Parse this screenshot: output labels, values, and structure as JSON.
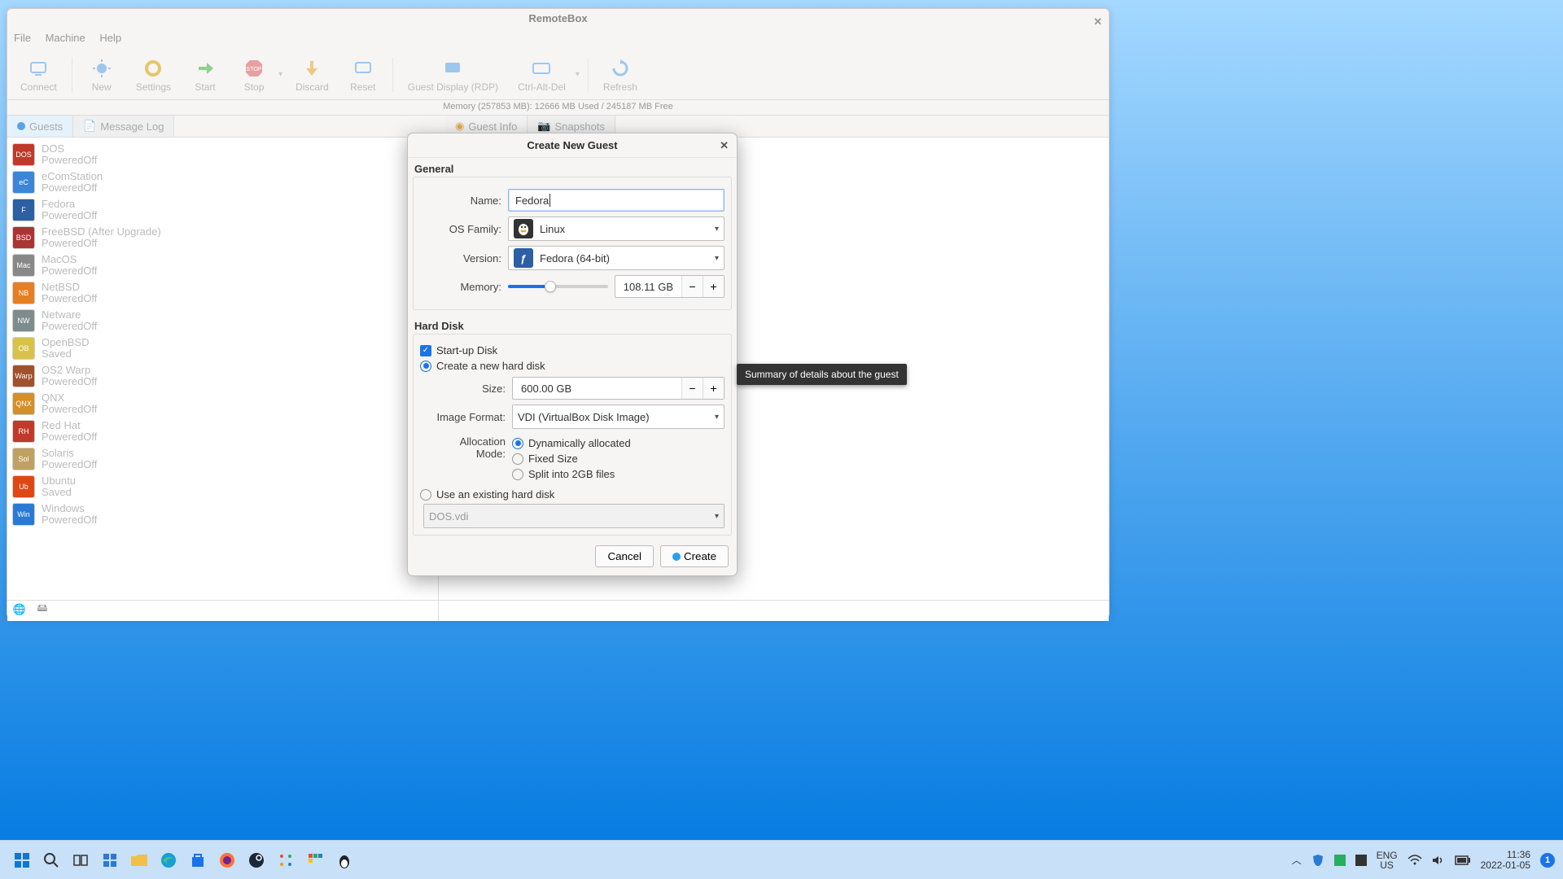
{
  "main_window": {
    "title": "RemoteBox",
    "menu": [
      "File",
      "Machine",
      "Help"
    ],
    "toolbar": [
      {
        "label": "Connect"
      },
      {
        "label": "New"
      },
      {
        "label": "Settings"
      },
      {
        "label": "Start"
      },
      {
        "label": "Stop"
      },
      {
        "label": "Discard"
      },
      {
        "label": "Reset"
      },
      {
        "label": "Guest Display (RDP)"
      },
      {
        "label": "Ctrl-Alt-Del"
      },
      {
        "label": "Refresh"
      }
    ],
    "memory_line": "Memory (257853 MB): 12666 MB Used / 245187 MB Free",
    "left_tabs": {
      "guests": "Guests",
      "msglog": "Message Log"
    },
    "right_tabs": {
      "guestinfo": "Guest Info",
      "snapshots": "Snapshots"
    },
    "guests": [
      {
        "name": "DOS",
        "state": "PoweredOff",
        "tag": "DOS",
        "bg": "#c0392b"
      },
      {
        "name": "eComStation",
        "state": "PoweredOff",
        "tag": "eC",
        "bg": "#3b86d6"
      },
      {
        "name": "Fedora",
        "state": "PoweredOff",
        "tag": "F",
        "bg": "#2c5fa4"
      },
      {
        "name": "FreeBSD (After Upgrade)",
        "state": "PoweredOff",
        "tag": "BSD",
        "bg": "#a33"
      },
      {
        "name": "MacOS",
        "state": "PoweredOff",
        "tag": "Mac",
        "bg": "#888"
      },
      {
        "name": "NetBSD",
        "state": "PoweredOff",
        "tag": "NB",
        "bg": "#e67e22"
      },
      {
        "name": "Netware",
        "state": "PoweredOff",
        "tag": "NW",
        "bg": "#7f8c8d"
      },
      {
        "name": "OpenBSD",
        "state": "Saved",
        "tag": "OB",
        "bg": "#d9c24a"
      },
      {
        "name": "OS2 Warp",
        "state": "PoweredOff",
        "tag": "Warp",
        "bg": "#a0522d"
      },
      {
        "name": "QNX",
        "state": "PoweredOff",
        "tag": "QNX",
        "bg": "#d48f2a"
      },
      {
        "name": "Red Hat",
        "state": "PoweredOff",
        "tag": "RH",
        "bg": "#c0392b"
      },
      {
        "name": "Solaris",
        "state": "PoweredOff",
        "tag": "Sol",
        "bg": "#bfa162"
      },
      {
        "name": "Ubuntu",
        "state": "Saved",
        "tag": "Ub",
        "bg": "#dd4814"
      },
      {
        "name": "Windows",
        "state": "PoweredOff",
        "tag": "Win",
        "bg": "#2a7ad4"
      }
    ]
  },
  "dialog": {
    "title": "Create New Guest",
    "section_general": "General",
    "name_label": "Name:",
    "name_value": "Fedora",
    "osfamily_label": "OS Family:",
    "osfamily_value": "Linux",
    "version_label": "Version:",
    "version_value": "Fedora (64-bit)",
    "memory_label": "Memory:",
    "memory_value": "108.11 GB",
    "memory_fill_pct": 42,
    "section_harddisk": "Hard Disk",
    "startup_disk": "Start-up Disk",
    "create_new": "Create a new hard disk",
    "size_label": "Size:",
    "size_value": "600.00 GB",
    "image_format_label": "Image Format:",
    "image_format_value": "VDI (VirtualBox Disk Image)",
    "alloc_label": "Allocation Mode:",
    "alloc_dynamic": "Dynamically allocated",
    "alloc_fixed": "Fixed Size",
    "alloc_split": "Split into 2GB files",
    "use_existing": "Use an existing hard disk",
    "existing_disk_value": "DOS.vdi",
    "cancel": "Cancel",
    "create": "Create"
  },
  "tooltip": "Summary of details about the guest",
  "taskbar": {
    "lang1": "ENG",
    "lang2": "US",
    "time": "11:36",
    "date": "2022-01-05"
  }
}
